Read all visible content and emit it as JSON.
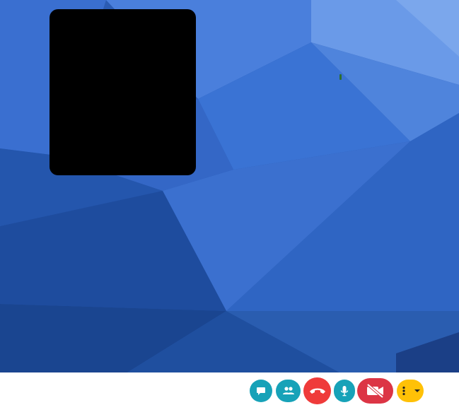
{
  "colors": {
    "background": "#2b5cb4",
    "accent": "#17a2b8",
    "hangup": "#ef3b3a",
    "camera_off": "#dc3545",
    "more_menu": "#ffc107"
  },
  "video": {
    "self_view": "black"
  },
  "toolbar": {
    "buttons": [
      {
        "name": "chat",
        "icon": "chat-bubble-icon"
      },
      {
        "name": "participants",
        "icon": "users-icon"
      },
      {
        "name": "hangup",
        "icon": "phone-hangup-icon"
      },
      {
        "name": "microphone",
        "icon": "microphone-icon"
      },
      {
        "name": "camera",
        "icon": "video-slash-icon"
      },
      {
        "name": "more",
        "icon": "more-vertical-icon"
      }
    ]
  }
}
